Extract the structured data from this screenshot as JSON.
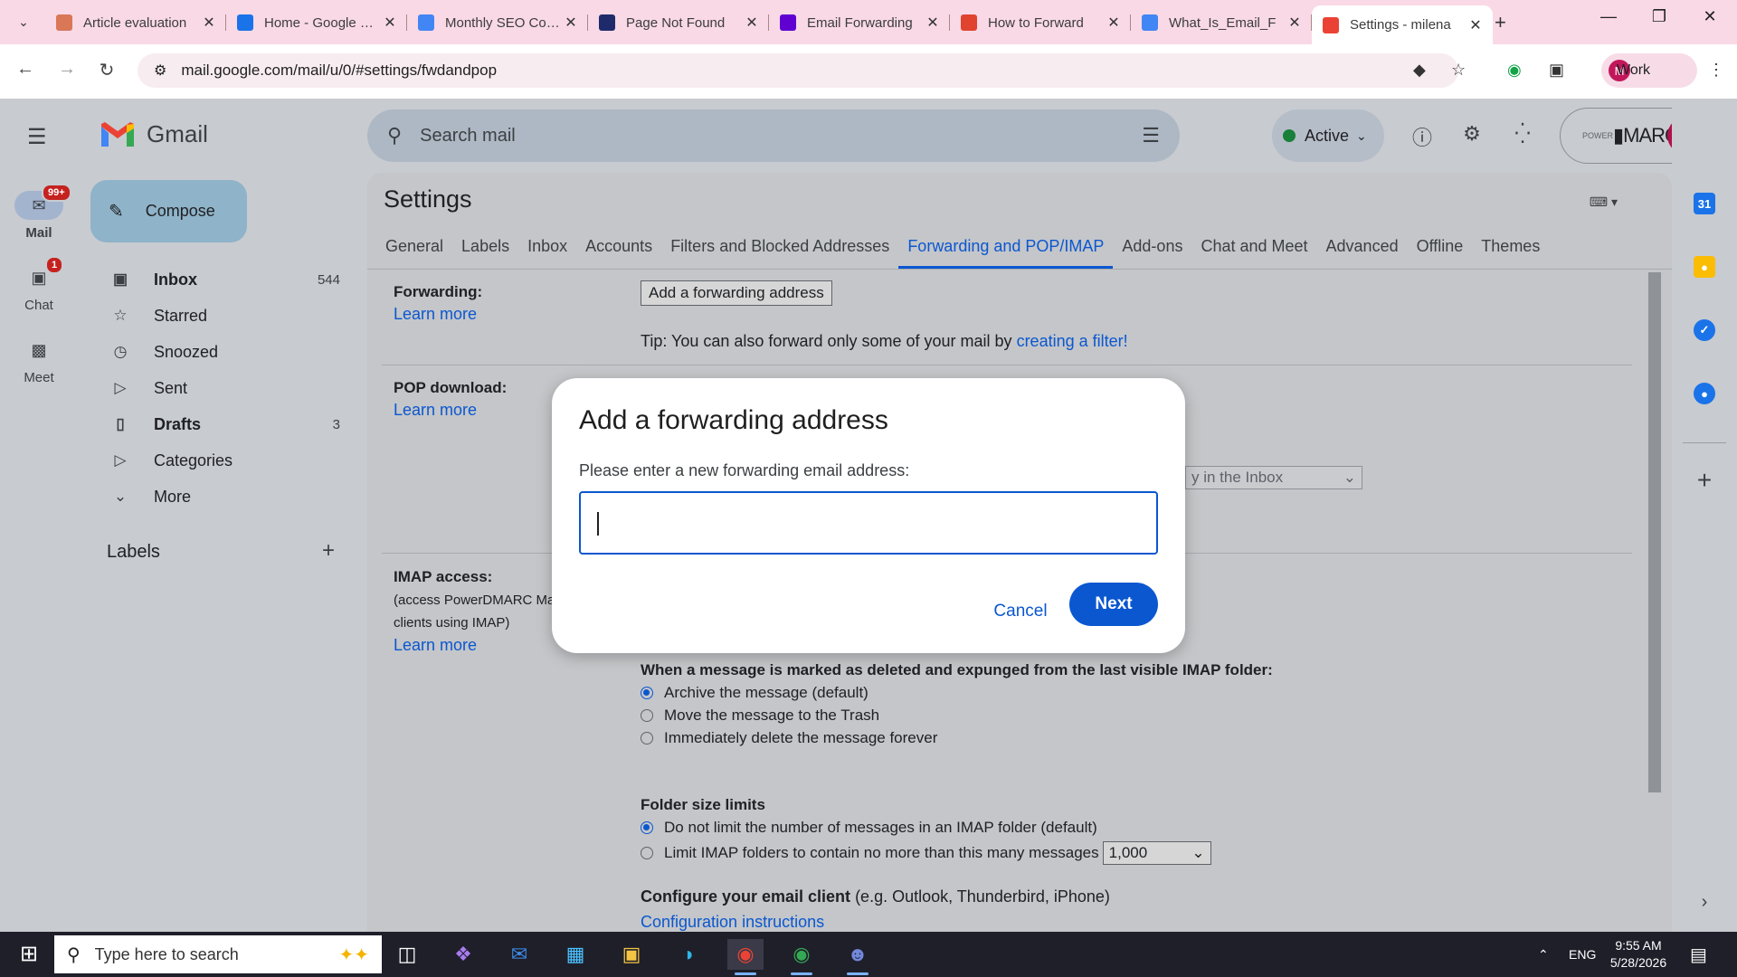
{
  "browser": {
    "tabs": [
      {
        "title": "Article evaluation",
        "icon": "claude-icon",
        "color": "#d97757"
      },
      {
        "title": "Home - Google Drive",
        "icon": "drive-icon",
        "color": "#1a73e8"
      },
      {
        "title": "Monthly SEO Content",
        "icon": "docs-icon",
        "color": "#4285f4"
      },
      {
        "title": "Page Not Found",
        "icon": "page-icon",
        "color": "#1f2a6b"
      },
      {
        "title": "Email Forwarding",
        "icon": "yahoo-icon",
        "color": "#6001d2"
      },
      {
        "title": "How to Forward",
        "icon": "site-icon",
        "color": "#e0442f"
      },
      {
        "title": "What_Is_Email_F",
        "icon": "docs-icon",
        "color": "#4285f4"
      },
      {
        "title": "Settings - milena",
        "icon": "gmail-icon",
        "color": "#ea4335",
        "active": true
      }
    ],
    "url": "mail.google.com/mail/u/0/#settings/fwdandpop",
    "profile_label": "Work",
    "profile_initial": "M"
  },
  "gmail": {
    "app_name": "Gmail",
    "compose_label": "Compose",
    "rail": [
      {
        "label": "Mail",
        "badge": "99+"
      },
      {
        "label": "Chat",
        "badge": "1"
      },
      {
        "label": "Meet",
        "badge": ""
      }
    ],
    "nav": [
      {
        "label": "Inbox",
        "count": "544",
        "bold": true
      },
      {
        "label": "Starred",
        "count": ""
      },
      {
        "label": "Snoozed",
        "count": ""
      },
      {
        "label": "Sent",
        "count": ""
      },
      {
        "label": "Drafts",
        "count": "3",
        "bold": true
      },
      {
        "label": "Categories",
        "count": ""
      },
      {
        "label": "More",
        "count": ""
      }
    ],
    "labels_heading": "Labels",
    "search_placeholder": "Search mail",
    "status": "Active",
    "account_brand": "MARC",
    "account_brand_prefix": "POWER",
    "account_initial": "M"
  },
  "settings": {
    "title": "Settings",
    "tabs": [
      "General",
      "Labels",
      "Inbox",
      "Accounts",
      "Filters and Blocked Addresses",
      "Forwarding and POP/IMAP",
      "Add-ons",
      "Chat and Meet",
      "Advanced",
      "Offline",
      "Themes"
    ],
    "selected_tab": "Forwarding and POP/IMAP",
    "forwarding_label": "Forwarding:",
    "learn_more": "Learn more",
    "add_forwarding_button": "Add a forwarding address",
    "tip_text": "Tip: You can also forward only some of your mail by",
    "tip_link": "creating a filter!",
    "pop_label": "POP download:",
    "pop_select": "y in the Inbox",
    "imap_label": "IMAP access:",
    "imap_note_1": "(access PowerDMARC Ma",
    "imap_note_2": "clients using IMAP)",
    "expunge_heading": "When a message is marked as deleted and expunged from the last visible IMAP folder:",
    "expunge_options": [
      "Archive the message (default)",
      "Move the message to the Trash",
      "Immediately delete the message forever"
    ],
    "folder_heading": "Folder size limits",
    "folder_options": [
      "Do not limit the number of messages in an IMAP folder (default)",
      "Limit IMAP folders to contain no more than this many messages"
    ],
    "folder_limit_value": "1,000",
    "configure_heading": "Configure your email client",
    "configure_note": "(e.g. Outlook, Thunderbird, iPhone)",
    "configure_link": "Configuration instructions"
  },
  "dialog": {
    "title": "Add a forwarding address",
    "prompt": "Please enter a new forwarding email address:",
    "input_value": "",
    "cancel_label": "Cancel",
    "next_label": "Next"
  },
  "taskbar": {
    "search_placeholder": "Type here to search",
    "language": "ENG",
    "time": "9:55 AM",
    "date": "5/28/2026"
  }
}
